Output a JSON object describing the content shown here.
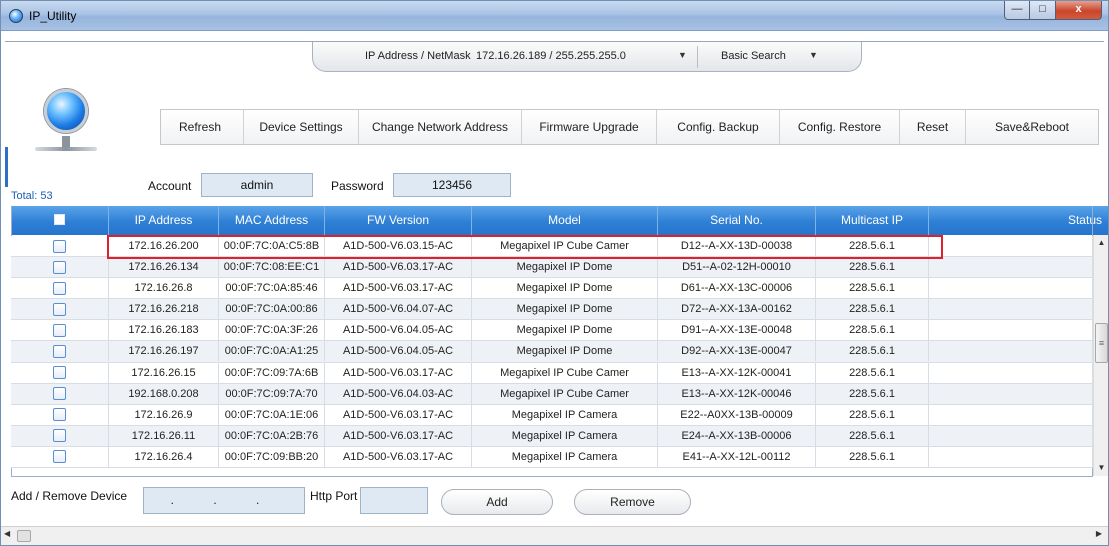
{
  "window": {
    "title": "IP_Utility",
    "minimize_glyph": "—",
    "maximize_glyph": "□",
    "close_glyph": "x"
  },
  "addressbar": {
    "label": "IP Address / NetMask",
    "value": "172.16.26.189 / 255.255.255.0",
    "dropdown_arrow": "▼",
    "search_mode": "Basic Search",
    "search_arrow": "▼"
  },
  "toolbar": {
    "refresh": "Refresh",
    "device_settings": "Device Settings",
    "change_network_address": "Change Network Address",
    "firmware_upgrade": "Firmware Upgrade",
    "config_backup": "Config. Backup",
    "config_restore": "Config. Restore",
    "reset": "Reset",
    "save_reboot": "Save&Reboot"
  },
  "login": {
    "account_label": "Account",
    "account_value": "admin",
    "password_label": "Password",
    "password_value": "123456"
  },
  "total_label": "Total: 53",
  "table": {
    "columns": [
      "IP Address",
      "MAC Address",
      "FW Version",
      "Model",
      "Serial No.",
      "Multicast IP",
      "Status"
    ],
    "rows": [
      {
        "ip": "172.16.26.200",
        "mac": "00:0F:7C:0A:C5:8B",
        "fw": "A1D-500-V6.03.15-AC",
        "model": "Megapixel IP Cube Camer",
        "serial": "D12--A-XX-13D-00038",
        "multicast": "228.5.6.1",
        "status": ""
      },
      {
        "ip": "172.16.26.134",
        "mac": "00:0F:7C:08:EE:C1",
        "fw": "A1D-500-V6.03.17-AC",
        "model": "Megapixel IP Dome",
        "serial": "D51--A-02-12H-00010",
        "multicast": "228.5.6.1",
        "status": ""
      },
      {
        "ip": "172.16.26.8",
        "mac": "00:0F:7C:0A:85:46",
        "fw": "A1D-500-V6.03.17-AC",
        "model": "Megapixel IP Dome",
        "serial": "D61--A-XX-13C-00006",
        "multicast": "228.5.6.1",
        "status": ""
      },
      {
        "ip": "172.16.26.218",
        "mac": "00:0F:7C:0A:00:86",
        "fw": "A1D-500-V6.04.07-AC",
        "model": "Megapixel IP Dome",
        "serial": "D72--A-XX-13A-00162",
        "multicast": "228.5.6.1",
        "status": ""
      },
      {
        "ip": "172.16.26.183",
        "mac": "00:0F:7C:0A:3F:26",
        "fw": "A1D-500-V6.04.05-AC",
        "model": "Megapixel IP Dome",
        "serial": "D91--A-XX-13E-00048",
        "multicast": "228.5.6.1",
        "status": ""
      },
      {
        "ip": "172.16.26.197",
        "mac": "00:0F:7C:0A:A1:25",
        "fw": "A1D-500-V6.04.05-AC",
        "model": "Megapixel IP Dome",
        "serial": "D92--A-XX-13E-00047",
        "multicast": "228.5.6.1",
        "status": ""
      },
      {
        "ip": "172.16.26.15",
        "mac": "00:0F:7C:09:7A:6B",
        "fw": "A1D-500-V6.03.17-AC",
        "model": "Megapixel IP Cube Camer",
        "serial": "E13--A-XX-12K-00041",
        "multicast": "228.5.6.1",
        "status": ""
      },
      {
        "ip": "192.168.0.208",
        "mac": "00:0F:7C:09:7A:70",
        "fw": "A1D-500-V6.04.03-AC",
        "model": "Megapixel IP Cube Camer",
        "serial": "E13--A-XX-12K-00046",
        "multicast": "228.5.6.1",
        "status": ""
      },
      {
        "ip": "172.16.26.9",
        "mac": "00:0F:7C:0A:1E:06",
        "fw": "A1D-500-V6.03.17-AC",
        "model": "Megapixel IP Camera",
        "serial": "E22--A0XX-13B-00009",
        "multicast": "228.5.6.1",
        "status": ""
      },
      {
        "ip": "172.16.26.11",
        "mac": "00:0F:7C:0A:2B:76",
        "fw": "A1D-500-V6.03.17-AC",
        "model": "Megapixel IP Camera",
        "serial": "E24--A-XX-13B-00006",
        "multicast": "228.5.6.1",
        "status": ""
      },
      {
        "ip": "172.16.26.4",
        "mac": "00:0F:7C:09:BB:20",
        "fw": "A1D-500-V6.03.17-AC",
        "model": "Megapixel IP Camera",
        "serial": "E41--A-XX-12L-00112",
        "multicast": "228.5.6.1",
        "status": ""
      }
    ],
    "highlighted_row_index": 0
  },
  "bottom": {
    "add_remove_label": "Add / Remove Device",
    "ip_placeholder": ". . .",
    "http_port_label": "Http Port",
    "http_port_value": "",
    "add_button": "Add",
    "remove_button": "Remove"
  },
  "scroll": {
    "up_arrow": "▲",
    "down_arrow": "▼",
    "left_arrow": "◀",
    "right_arrow": "▶",
    "grip": "≡"
  },
  "colors": {
    "header_blue": "#2e7fd6",
    "highlight_red": "#e0202a",
    "field_bg": "#dfe9f3",
    "total_text": "#1d5fb3"
  }
}
